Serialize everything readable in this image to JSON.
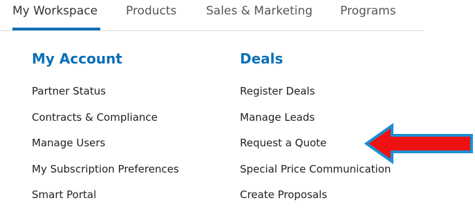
{
  "nav": {
    "tabs": [
      {
        "label": "My Workspace"
      },
      {
        "label": "Products"
      },
      {
        "label": "Sales & Marketing"
      },
      {
        "label": "Programs"
      }
    ]
  },
  "menu": {
    "my_account": {
      "title": "My Account",
      "items": [
        "Partner Status",
        "Contracts & Compliance",
        "Manage Users",
        "My Subscription Preferences",
        "Smart Portal"
      ]
    },
    "deals": {
      "title": "Deals",
      "items": [
        "Register Deals",
        "Manage Leads",
        "Request a Quote",
        "Special Price Communication",
        "Create Proposals"
      ]
    }
  },
  "annotation": {
    "arrow_fill": "#ee1111",
    "arrow_outline": "#1a8fd6",
    "arrow_points_to": "Request a Quote"
  },
  "colors": {
    "accent": "#0b6fb8",
    "text": "#1f1f1f",
    "tab_text": "#555555",
    "divider": "#d6d6d6"
  }
}
